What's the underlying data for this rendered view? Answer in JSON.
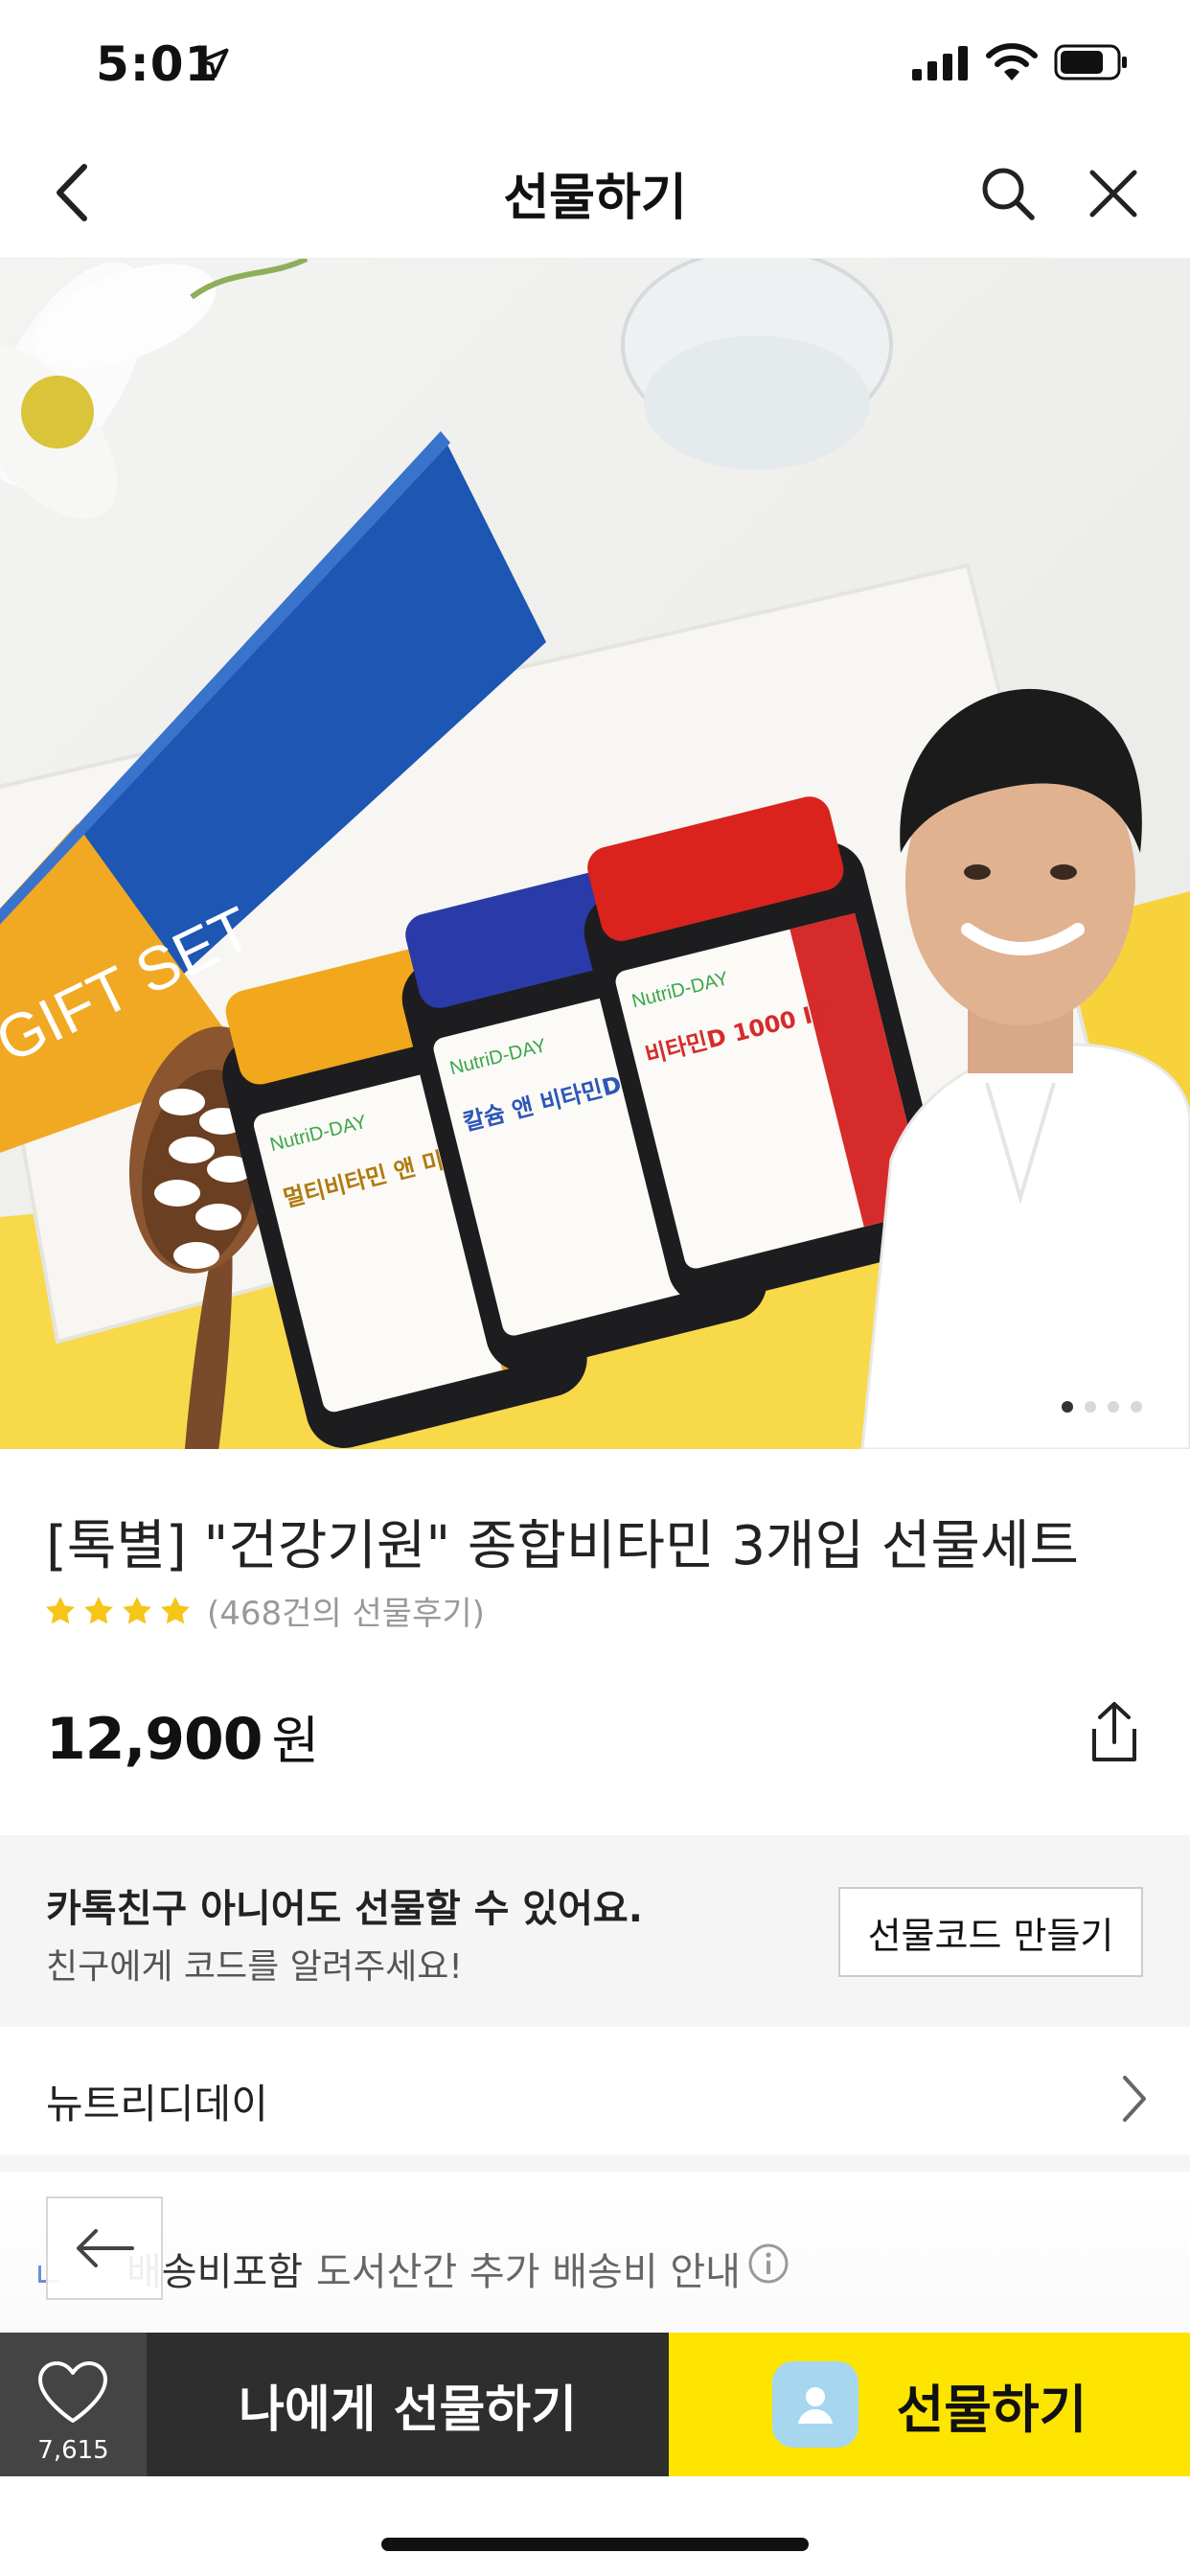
{
  "status_bar": {
    "time": "5:01"
  },
  "header": {
    "title": "선물하기"
  },
  "hero": {
    "box_text": "GIFT SET",
    "bottles": [
      {
        "brand": "NutriD-DAY",
        "name": "멀티비타민 앤 미네랄",
        "cap_color": "#f2a81c",
        "label_color": "#e9a727"
      },
      {
        "brand": "NutriD-DAY",
        "name": "칼슘 앤 비타민D",
        "cap_color": "#2a3aa8",
        "label_color": "#2d56b8"
      },
      {
        "brand": "NutriD-DAY",
        "name": "비타민D 1000 IU",
        "cap_color": "#d9231c",
        "label_color": "#d62b2b"
      }
    ],
    "pager": {
      "total": 4,
      "current": 1
    }
  },
  "product": {
    "title": "[톡별] \"건강기원\" 종합비타민 3개입 선물세트",
    "rating_stars": 4,
    "review_count": "(468건의 선물후기)",
    "price": "12,900",
    "price_unit": "원"
  },
  "gift_code": {
    "line1": "카톡친구 아니어도 선물할 수 있어요.",
    "line2": "친구에게 코드를 알려주세요!",
    "button": "선물코드 만들기"
  },
  "brand": {
    "name": "뉴트리디데이"
  },
  "shipping": {
    "label": "배송비포함",
    "note": "도서산간 추가 배송비 안내"
  },
  "bottom_bar": {
    "like_count": "7,615",
    "self_gift": "나에게 선물하기",
    "gift": "선물하기"
  },
  "colors": {
    "kakao_yellow": "#fee500",
    "star": "#f5c518",
    "dark": "#2e2e2e"
  }
}
